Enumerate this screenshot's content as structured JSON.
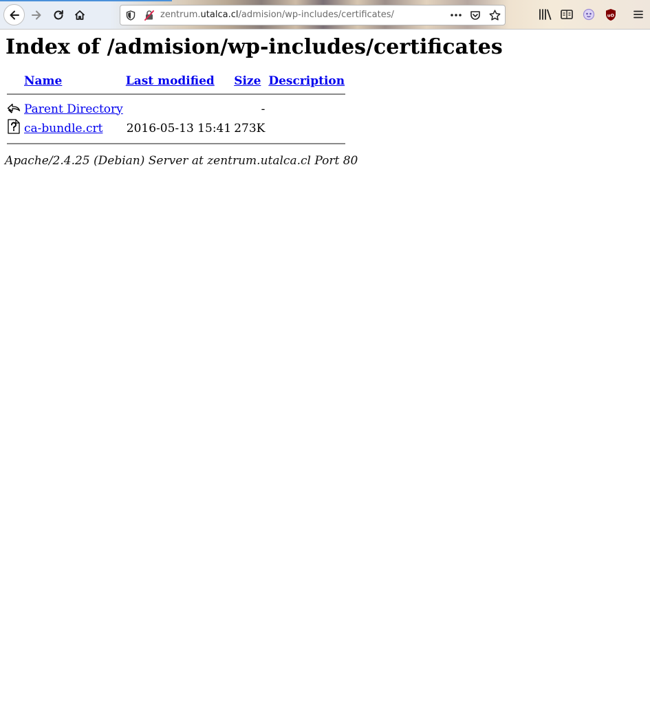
{
  "browser": {
    "url_prefix": "zentrum.",
    "url_domain": "utalca.cl",
    "url_path": "/admision/wp-includes/certificates/",
    "icons": {
      "back": "back-arrow-icon",
      "forward": "forward-arrow-icon",
      "reload": "reload-icon",
      "home": "home-icon",
      "tracking": "shield-icon",
      "insecure": "insecure-lock-icon",
      "page_actions": "more-icon",
      "pocket": "pocket-icon",
      "bookmark": "star-icon",
      "library": "library-icon",
      "reader": "reader-view-icon",
      "extension": "extension-icon",
      "ublock": "ublock-icon",
      "menu": "hamburger-menu-icon"
    },
    "ublock_label": "uO"
  },
  "page": {
    "title": "Index of /admision/wp-includes/certificates",
    "columns": {
      "name": "Name",
      "modified": "Last modified",
      "size": "Size",
      "description": "Description"
    },
    "rows": [
      {
        "icon": "back-folder-icon",
        "name": "Parent Directory",
        "modified": "",
        "size": "-",
        "description": ""
      },
      {
        "icon": "unknown-file-icon",
        "name": "ca-bundle.crt",
        "modified": "2016-05-13 15:41",
        "size": "273K",
        "description": ""
      }
    ],
    "footer": "Apache/2.4.25 (Debian) Server at zentrum.utalca.cl Port 80"
  },
  "colors": {
    "link": "#0000ee",
    "rule": "#8a8a8a",
    "ublock": "#800000"
  }
}
